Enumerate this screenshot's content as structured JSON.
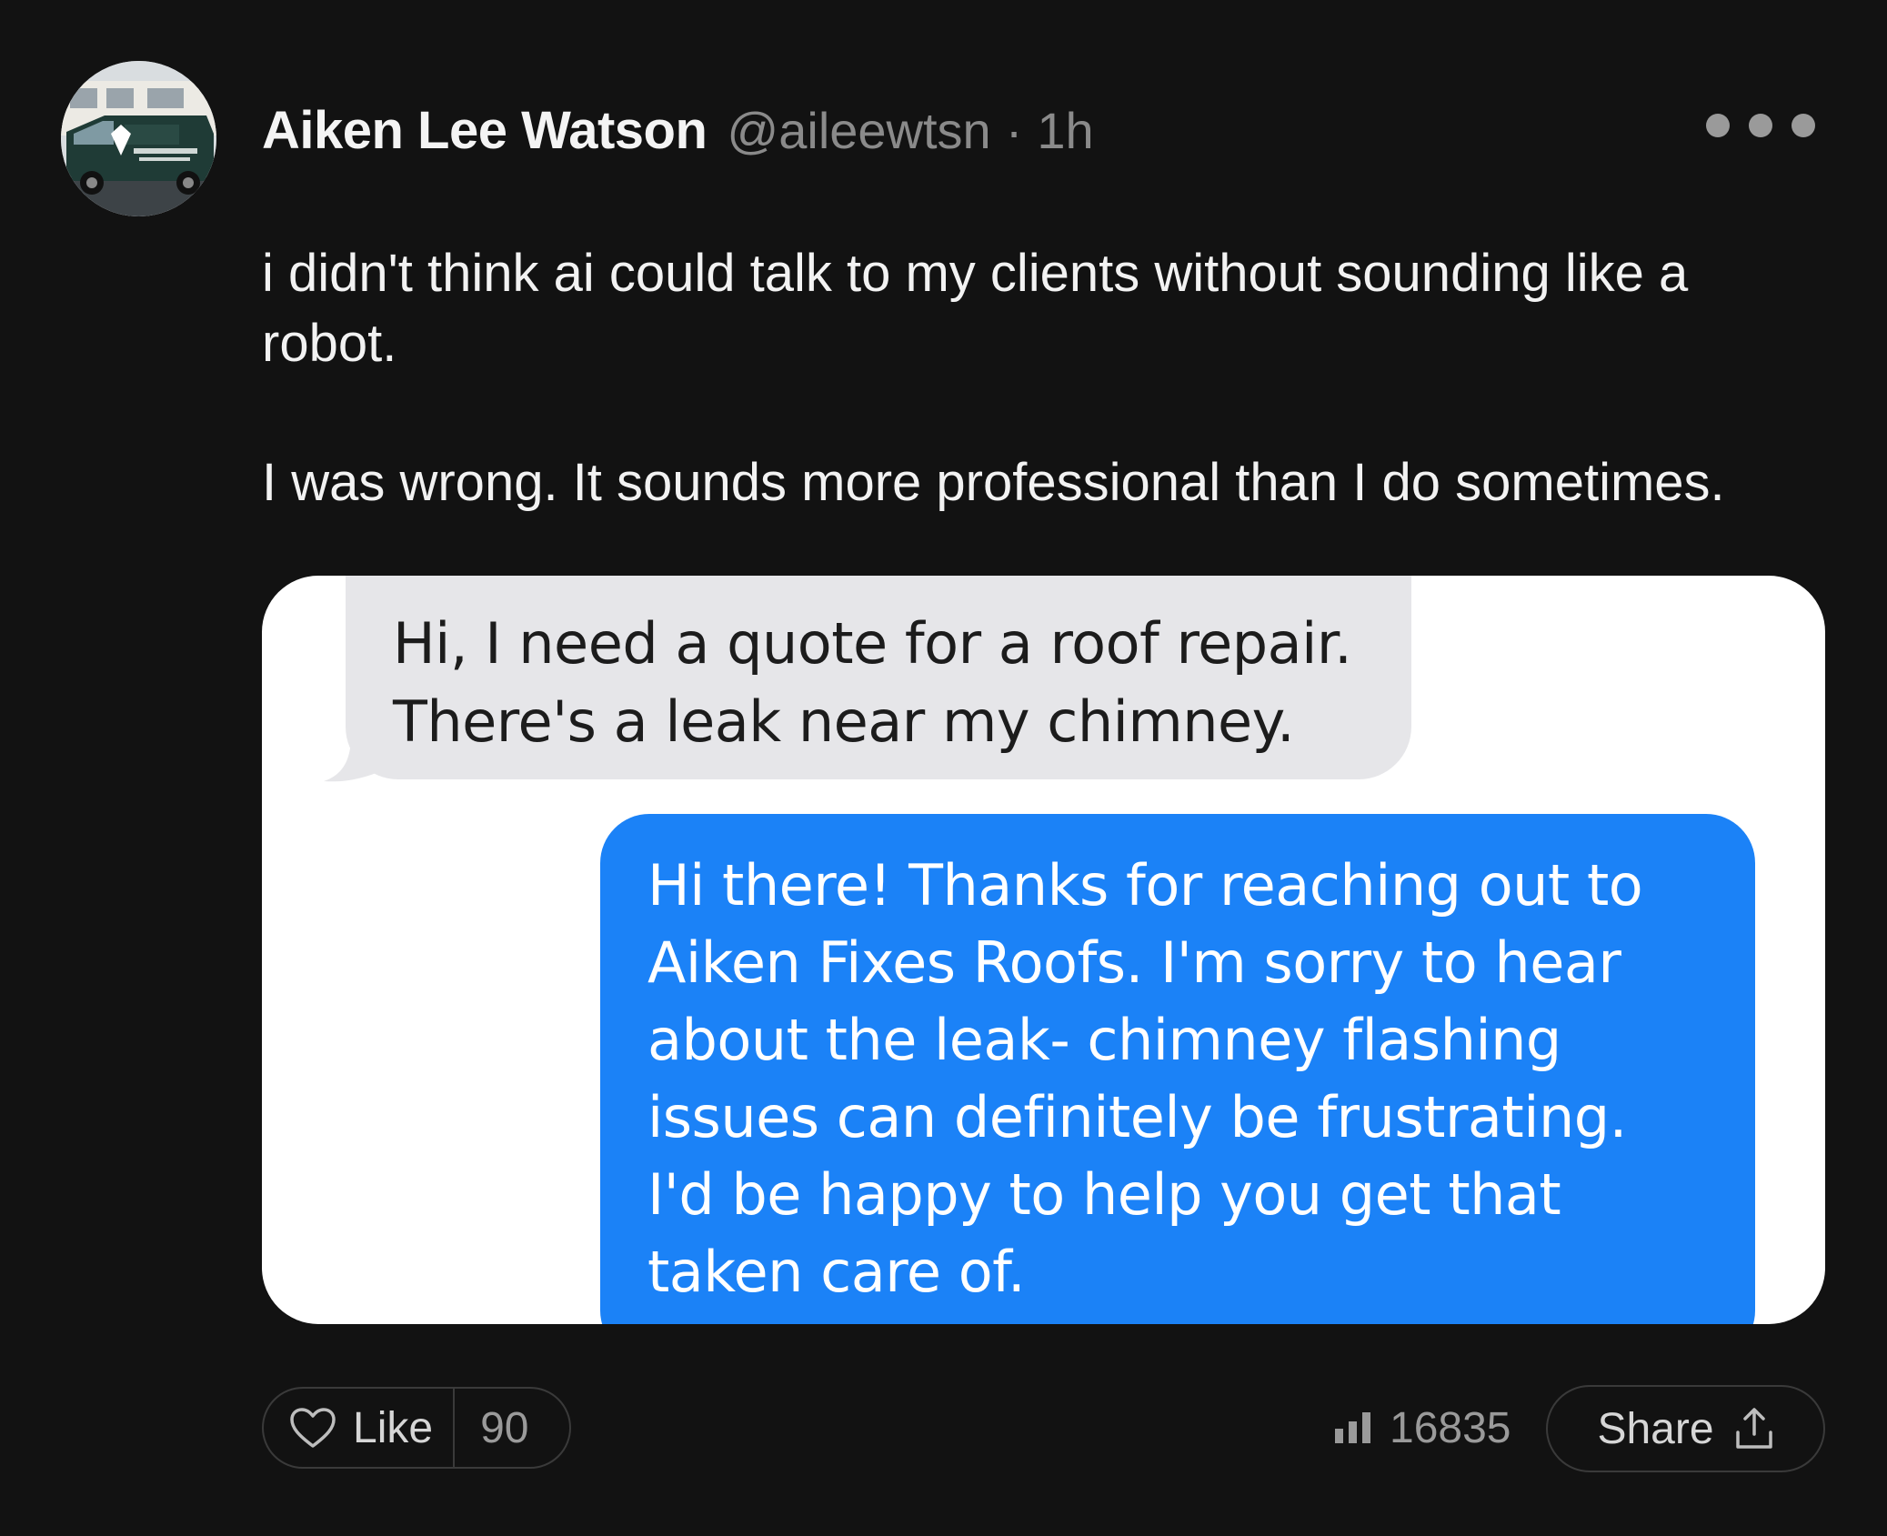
{
  "post": {
    "author": {
      "name": "Aiken Lee Watson",
      "handle": "@aileewtsn",
      "separator": "·",
      "time": "1h",
      "avatar_icon": "roofing-van-avatar"
    },
    "more_icon": "more-horizontal-icon",
    "text": {
      "paragraph_1": "i didn't think ai could talk to my clients without sounding like a robot.",
      "paragraph_2": "I was wrong. It sounds more professional than I do sometimes."
    },
    "media": {
      "incoming_message": {
        "lines": [
          "Hi, I need a quote for a roof repair.",
          "There's a leak near my chimney."
        ],
        "color": "#e6e6e9"
      },
      "outgoing_message": {
        "lines": [
          "Hi there! Thanks for reaching out to",
          "Aiken Fixes Roofs. I'm sorry to hear",
          "about the leak- chimney flashing",
          "issues can definitely be frustrating.",
          "I'd be happy to help you get that",
          "taken care of."
        ],
        "color": "#1b82f7"
      }
    },
    "actions": {
      "like_label": "Like",
      "like_count": "90",
      "like_icon": "heart-icon",
      "views_count": "16835",
      "views_icon": "bar-chart-icon",
      "share_label": "Share",
      "share_icon": "share-upload-icon"
    }
  },
  "colors": {
    "background": "#121212",
    "muted_text": "#8a8a8a",
    "border": "#3a3a3a"
  }
}
